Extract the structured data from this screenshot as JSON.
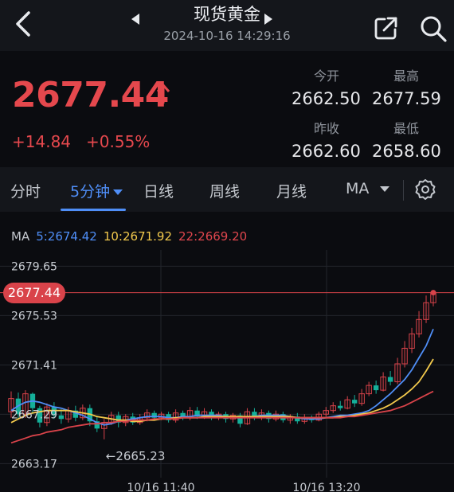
{
  "header": {
    "title": "现货黄金",
    "datetime": "2024-10-16 14:29:16",
    "icons": [
      "back-chevron-icon",
      "prev-triangle-icon",
      "next-triangle-icon",
      "share-icon",
      "search-icon"
    ]
  },
  "quote": {
    "price": "2677.44",
    "change": "+14.84",
    "change_pct": "+0.55%",
    "open_label": "今开",
    "open": "2662.50",
    "high_label": "最高",
    "high": "2677.59",
    "prev_close_label": "昨收",
    "prev_close": "2662.60",
    "low_label": "最低",
    "low": "2658.60",
    "up_color": "#e5484d"
  },
  "tabs": [
    "分时",
    "5分钟",
    "日线",
    "周线",
    "月线",
    "MA"
  ],
  "active_tab": "5分钟",
  "ma": {
    "label": "MA",
    "ma5": "5:2674.42",
    "ma10": "10:2671.92",
    "ma22": "22:2669.20",
    "colors": {
      "ma5": "#4f8ef7",
      "ma10": "#f2c94c",
      "ma22": "#d9434a"
    }
  },
  "chart": {
    "y_labels": [
      "2679.65",
      "2675.53",
      "2671.41",
      "2667.29",
      "2663.17"
    ],
    "x_labels": [
      "10/16 11:40",
      "10/16 13:20"
    ],
    "current_price_tag": "2677.44",
    "low_marker": "←2665.23",
    "colors": {
      "up": "#d9434a",
      "down": "#15b09a"
    }
  },
  "chart_data": {
    "type": "candlestick",
    "ylim": [
      2662,
      2681
    ],
    "tick_labels": [
      "2679.65",
      "2675.53",
      "2671.41",
      "2667.29",
      "2663.17"
    ],
    "x_tick_labels": [
      "10/16 11:40",
      "10/16 13:20"
    ],
    "series": [
      {
        "name": "MA5",
        "values": [
          2667.6,
          2668.0,
          2668.3,
          2668.4,
          2668.3,
          2668.1,
          2667.9,
          2667.8,
          2667.6,
          2667.4,
          2667.2,
          2666.9,
          2666.6,
          2666.4,
          2666.5,
          2666.7,
          2666.8,
          2666.9,
          2667.0,
          2667.1,
          2667.1,
          2667.1,
          2667.0,
          2667.0,
          2667.1,
          2667.1,
          2667.2,
          2667.2,
          2667.2,
          2667.2,
          2667.1,
          2667.0,
          2667.0,
          2667.1,
          2667.1,
          2667.2,
          2667.2,
          2667.2,
          2667.2,
          2667.1,
          2667.0,
          2666.9,
          2666.9,
          2666.9,
          2667.0,
          2667.1,
          2667.2,
          2667.2,
          2667.3,
          2667.4,
          2667.6,
          2668.0,
          2668.5,
          2669.0,
          2669.6,
          2670.2,
          2671.0,
          2672.0,
          2673.0,
          2674.4
        ]
      },
      {
        "name": "MA10",
        "values": [
          2666.6,
          2666.9,
          2667.2,
          2667.4,
          2667.5,
          2667.6,
          2667.6,
          2667.6,
          2667.6,
          2667.5,
          2667.4,
          2667.3,
          2667.1,
          2667.0,
          2666.9,
          2666.8,
          2666.8,
          2666.7,
          2666.7,
          2666.8,
          2666.8,
          2666.9,
          2666.9,
          2667.0,
          2667.0,
          2667.0,
          2667.0,
          2667.1,
          2667.1,
          2667.1,
          2667.1,
          2667.1,
          2667.1,
          2667.1,
          2667.1,
          2667.1,
          2667.1,
          2667.1,
          2667.1,
          2667.1,
          2667.0,
          2667.0,
          2667.0,
          2667.0,
          2667.0,
          2667.0,
          2667.1,
          2667.1,
          2667.2,
          2667.3,
          2667.4,
          2667.6,
          2667.8,
          2668.1,
          2668.5,
          2668.9,
          2669.4,
          2670.0,
          2670.9,
          2671.9
        ]
      },
      {
        "name": "MA22",
        "values": [
          2664.9,
          2665.1,
          2665.3,
          2665.5,
          2665.6,
          2665.8,
          2665.9,
          2666.0,
          2666.2,
          2666.3,
          2666.4,
          2666.5,
          2666.5,
          2666.6,
          2666.6,
          2666.7,
          2666.7,
          2666.8,
          2666.8,
          2666.8,
          2666.9,
          2666.9,
          2666.9,
          2666.9,
          2667.0,
          2667.0,
          2667.0,
          2667.0,
          2667.0,
          2667.0,
          2667.0,
          2667.0,
          2667.0,
          2667.0,
          2667.0,
          2667.0,
          2667.0,
          2667.0,
          2667.0,
          2667.0,
          2667.0,
          2667.0,
          2667.0,
          2667.0,
          2667.0,
          2667.0,
          2667.0,
          2667.1,
          2667.1,
          2667.2,
          2667.3,
          2667.4,
          2667.5,
          2667.6,
          2667.8,
          2668.0,
          2668.3,
          2668.6,
          2668.9,
          2669.2
        ]
      }
    ],
    "candles": [
      [
        2667.5,
        2668.6,
        2669.2,
        2667.0
      ],
      [
        2668.6,
        2667.3,
        2669.1,
        2666.9
      ],
      [
        2667.3,
        2669.0,
        2669.3,
        2667.0
      ],
      [
        2669.0,
        2667.8,
        2669.1,
        2667.3
      ],
      [
        2667.8,
        2666.6,
        2668.0,
        2666.2
      ],
      [
        2666.6,
        2667.9,
        2668.2,
        2666.3
      ],
      [
        2667.9,
        2667.2,
        2668.3,
        2666.9
      ],
      [
        2667.2,
        2666.9,
        2667.7,
        2666.5
      ],
      [
        2666.9,
        2667.6,
        2667.9,
        2666.6
      ],
      [
        2667.6,
        2667.0,
        2668.0,
        2666.7
      ],
      [
        2667.0,
        2667.8,
        2668.1,
        2666.8
      ],
      [
        2667.8,
        2666.7,
        2668.1,
        2666.3
      ],
      [
        2666.7,
        2666.1,
        2667.1,
        2665.8
      ],
      [
        2666.1,
        2666.6,
        2666.9,
        2665.2
      ],
      [
        2666.6,
        2667.2,
        2667.5,
        2666.4
      ],
      [
        2667.2,
        2666.6,
        2667.5,
        2666.2
      ],
      [
        2666.6,
        2667.1,
        2667.3,
        2666.3
      ],
      [
        2667.1,
        2666.6,
        2667.4,
        2666.4
      ],
      [
        2666.6,
        2667.0,
        2667.3,
        2666.4
      ],
      [
        2667.0,
        2667.4,
        2667.7,
        2666.7
      ],
      [
        2667.4,
        2667.0,
        2667.6,
        2666.8
      ],
      [
        2667.0,
        2667.3,
        2667.5,
        2666.8
      ],
      [
        2667.3,
        2666.8,
        2667.5,
        2666.6
      ],
      [
        2666.8,
        2667.4,
        2667.7,
        2666.6
      ],
      [
        2667.4,
        2667.0,
        2667.6,
        2666.8
      ],
      [
        2667.0,
        2667.6,
        2667.9,
        2666.8
      ],
      [
        2667.6,
        2667.1,
        2667.9,
        2666.9
      ],
      [
        2667.1,
        2667.5,
        2667.8,
        2666.9
      ],
      [
        2667.5,
        2667.0,
        2667.7,
        2666.8
      ],
      [
        2667.0,
        2667.3,
        2667.5,
        2666.8
      ],
      [
        2667.3,
        2666.9,
        2667.5,
        2666.6
      ],
      [
        2666.9,
        2667.2,
        2667.4,
        2666.6
      ],
      [
        2667.2,
        2666.5,
        2667.4,
        2666.2
      ],
      [
        2666.5,
        2667.5,
        2667.8,
        2666.4
      ],
      [
        2667.5,
        2667.0,
        2667.8,
        2666.8
      ],
      [
        2667.0,
        2667.4,
        2667.7,
        2666.8
      ],
      [
        2667.4,
        2666.9,
        2667.6,
        2666.6
      ],
      [
        2666.9,
        2667.3,
        2667.6,
        2666.7
      ],
      [
        2667.3,
        2666.8,
        2667.5,
        2666.6
      ],
      [
        2666.8,
        2667.1,
        2667.3,
        2666.5
      ],
      [
        2667.1,
        2666.7,
        2667.4,
        2666.5
      ],
      [
        2666.7,
        2667.0,
        2667.3,
        2666.5
      ],
      [
        2667.0,
        2666.8,
        2667.2,
        2666.6
      ],
      [
        2666.8,
        2667.3,
        2667.5,
        2666.7
      ],
      [
        2667.3,
        2667.6,
        2667.9,
        2667.1
      ],
      [
        2667.6,
        2668.0,
        2668.3,
        2667.4
      ],
      [
        2668.0,
        2667.8,
        2668.4,
        2667.6
      ],
      [
        2667.8,
        2668.5,
        2668.8,
        2667.7
      ],
      [
        2668.5,
        2668.2,
        2668.9,
        2667.9
      ],
      [
        2668.2,
        2669.0,
        2669.4,
        2668.0
      ],
      [
        2669.0,
        2669.7,
        2670.0,
        2668.8
      ],
      [
        2669.7,
        2669.3,
        2670.1,
        2669.0
      ],
      [
        2669.3,
        2670.4,
        2670.8,
        2669.2
      ],
      [
        2670.4,
        2670.0,
        2670.9,
        2669.7
      ],
      [
        2670.0,
        2671.5,
        2672.0,
        2669.8
      ],
      [
        2671.5,
        2672.8,
        2673.4,
        2671.2
      ],
      [
        2672.8,
        2674.0,
        2674.5,
        2672.4
      ],
      [
        2674.0,
        2675.2,
        2675.9,
        2673.7
      ],
      [
        2675.2,
        2676.6,
        2677.2,
        2674.9
      ],
      [
        2676.6,
        2677.44,
        2677.59,
        2676.3
      ]
    ]
  }
}
